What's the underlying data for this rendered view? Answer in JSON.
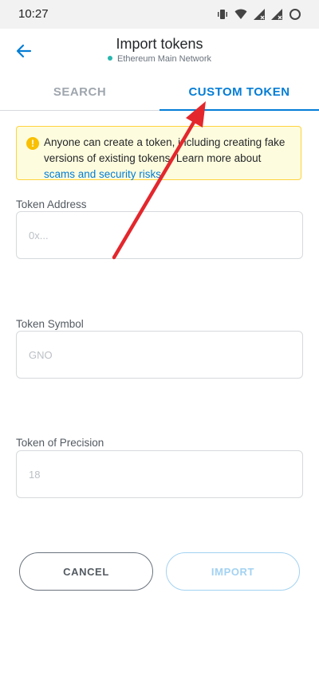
{
  "status_bar": {
    "time": "10:27"
  },
  "header": {
    "title": "Import tokens",
    "network": "Ethereum Main Network"
  },
  "tabs": [
    {
      "label": "SEARCH",
      "active": false
    },
    {
      "label": "CUSTOM TOKEN",
      "active": true
    }
  ],
  "warning": {
    "text": "Anyone can create a token, including creating fake versions of existing tokens. Learn more about ",
    "link": "scams and security risks."
  },
  "fields": {
    "address": {
      "label": "Token Address",
      "placeholder": "0x..."
    },
    "symbol": {
      "label": "Token Symbol",
      "placeholder": "GNO"
    },
    "precision": {
      "label": "Token of Precision",
      "placeholder": "18"
    }
  },
  "buttons": {
    "cancel": "CANCEL",
    "import": "IMPORT"
  },
  "colors": {
    "accent": "#037dd6",
    "warning_bg": "#fefcde",
    "annotation_arrow": "#e3272d"
  }
}
